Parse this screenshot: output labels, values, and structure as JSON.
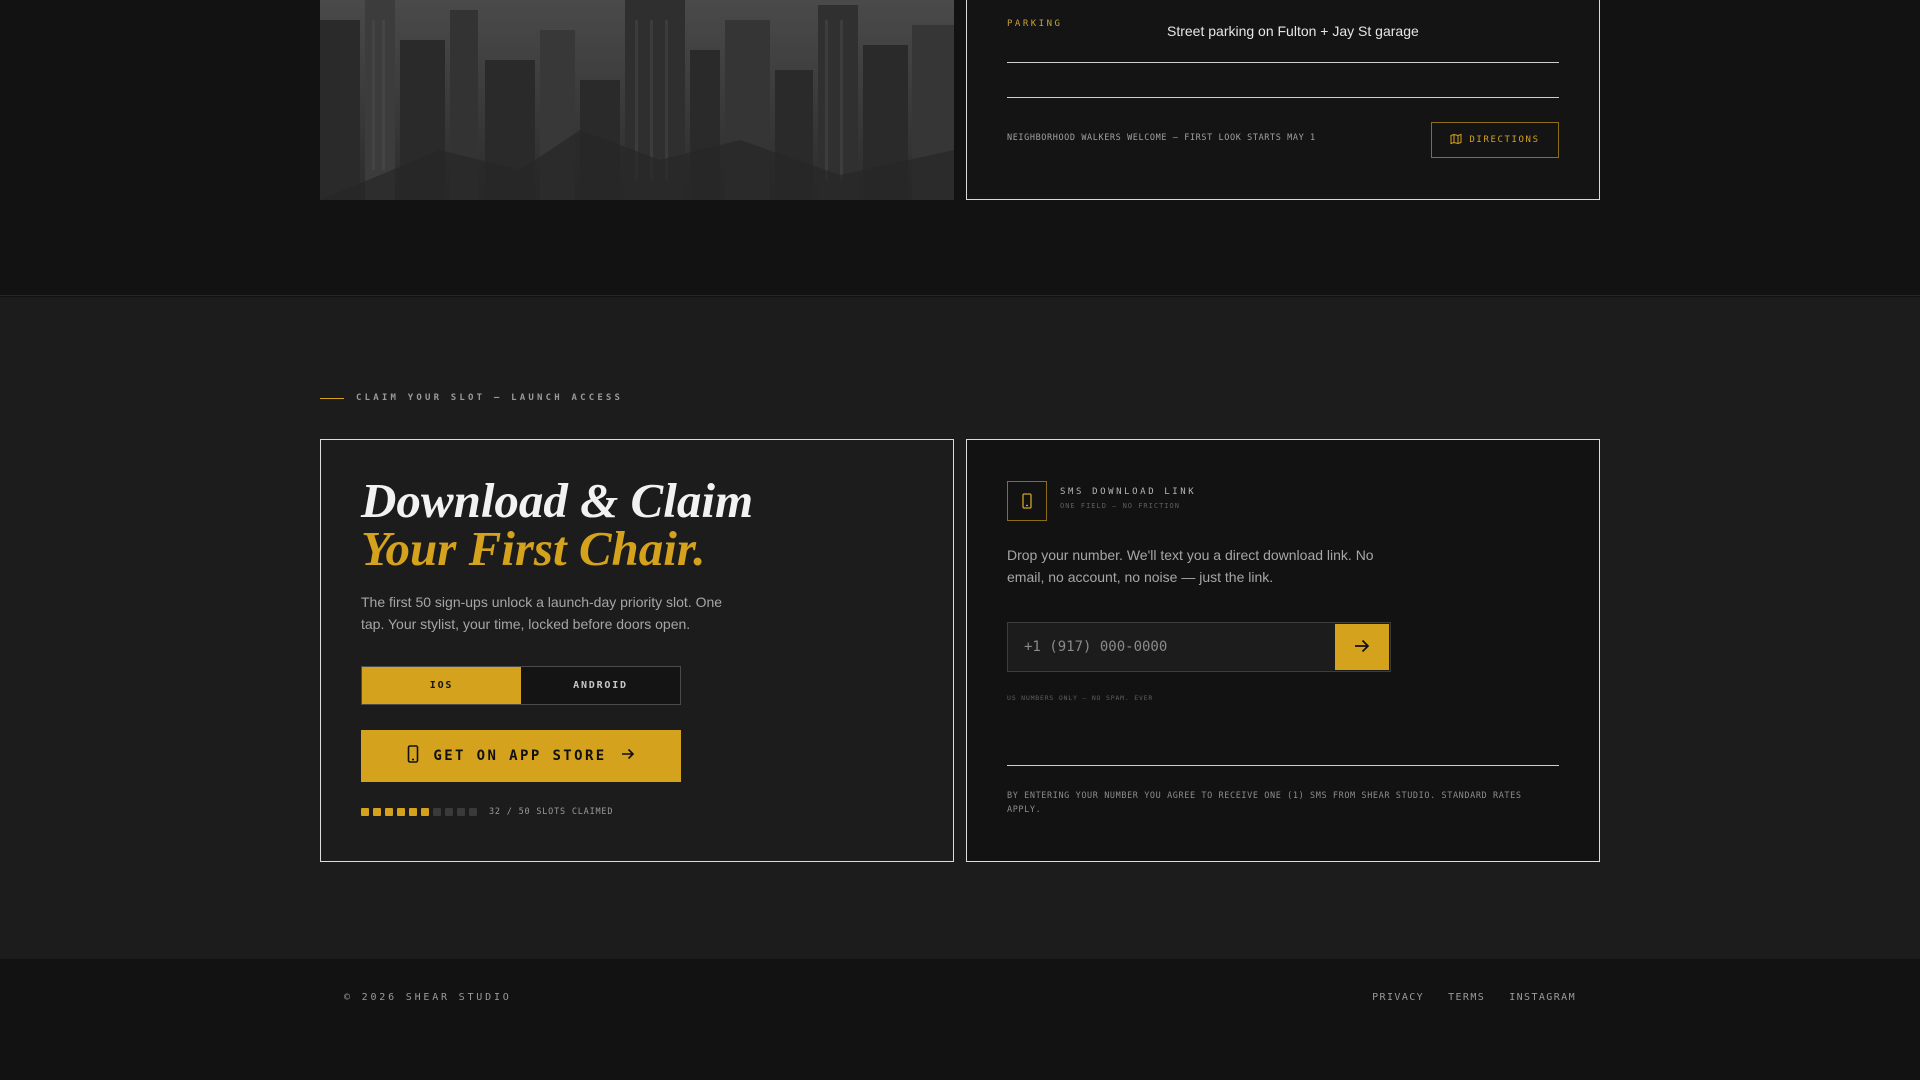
{
  "location": {
    "parking_label": "PARKING",
    "parking_value": "Street parking on Fulton + Jay St garage",
    "walk_note": "NEIGHBORHOOD WALKERS WELCOME — FIRST LOOK STARTS MAY 1",
    "directions_label": "DIRECTIONS"
  },
  "claim": {
    "eyebrow": "CLAIM YOUR SLOT — LAUNCH ACCESS",
    "heading_line1": "Download & Claim",
    "heading_line2": "Your First Chair.",
    "lead": "The first 50 sign-ups unlock a launch-day priority slot. One tap. Your stylist, your time, locked before doors open.",
    "os_options": [
      "IOS",
      "ANDROID"
    ],
    "os_selected": "IOS",
    "store_button": "GET ON APP STORE",
    "slots_claimed": 32,
    "slots_total": 50,
    "slots_text": "32 / 50 SLOTS CLAIMED"
  },
  "sms": {
    "title": "SMS DOWNLOAD LINK",
    "subtitle": "ONE FIELD — NO FRICTION",
    "description": "Drop your number. We'll text you a direct download link. No email, no account, no noise — just the link.",
    "phone_placeholder": "+1 (917) 000-0000",
    "phone_value": "",
    "us_note": "US NUMBERS ONLY — NO SPAM. EVER",
    "legal": "BY ENTERING YOUR NUMBER YOU AGREE TO RECEIVE ONE (1) SMS FROM SHEAR STUDIO. STANDARD RATES APPLY."
  },
  "footer": {
    "copyright": "© 2026 SHEAR STUDIO",
    "links": [
      "PRIVACY",
      "TERMS",
      "INSTAGRAM"
    ]
  },
  "icons": {
    "directions": "map-icon",
    "store": "phone-icon",
    "store_arrow": "arrow-right-icon",
    "sms": "phone-icon",
    "send": "arrow-right-icon"
  },
  "colors": {
    "accent": "#d4a21d",
    "background": "#121212",
    "section": "#1c1c1c",
    "border": "#dcdcdc"
  }
}
